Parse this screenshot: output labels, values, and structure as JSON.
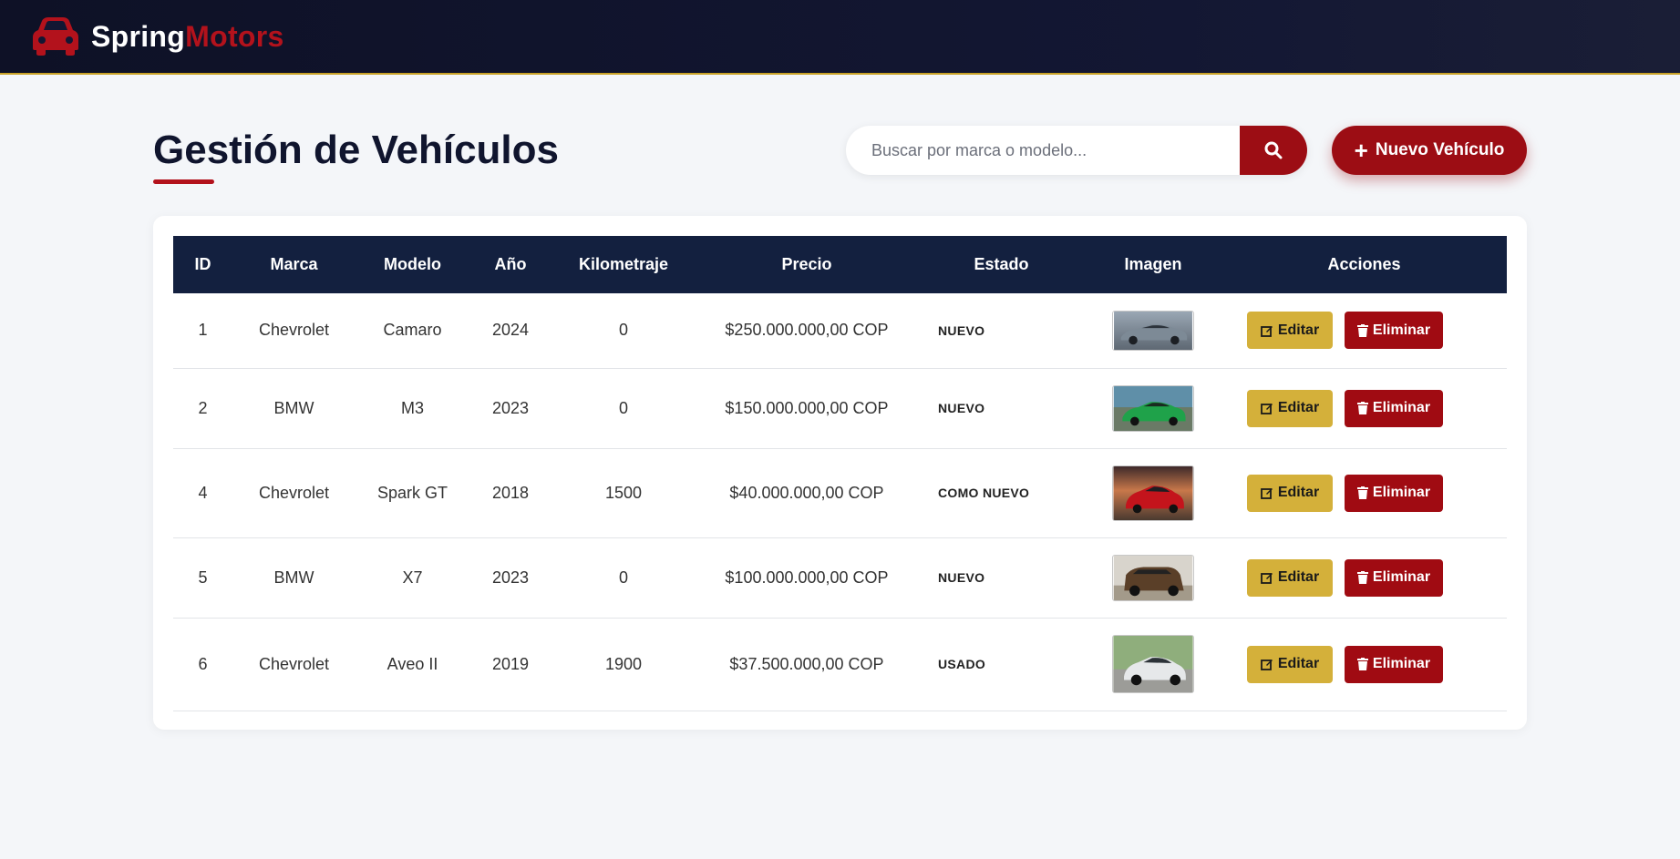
{
  "brand": {
    "part1": "Spring",
    "part2": "Motors",
    "icon": "car-icon"
  },
  "page": {
    "title": "Gestión de Vehículos"
  },
  "search": {
    "placeholder": "Buscar por marca o modelo...",
    "value": "",
    "button_icon": "search-icon"
  },
  "new_button": {
    "label": "Nuevo Vehículo",
    "icon": "plus-icon"
  },
  "table": {
    "headers": [
      "ID",
      "Marca",
      "Modelo",
      "Año",
      "Kilometraje",
      "Precio",
      "Estado",
      "Imagen",
      "Acciones"
    ],
    "rows": [
      {
        "id": "1",
        "marca": "Chevrolet",
        "modelo": "Camaro",
        "anio": "2024",
        "km": "0",
        "precio": "$250.000.000,00 COP",
        "estado": "NUEVO",
        "image_desc": "gray sports car"
      },
      {
        "id": "2",
        "marca": "BMW",
        "modelo": "M3",
        "anio": "2023",
        "km": "0",
        "precio": "$150.000.000,00 COP",
        "estado": "NUEVO",
        "image_desc": "green sedan"
      },
      {
        "id": "4",
        "marca": "Chevrolet",
        "modelo": "Spark GT",
        "anio": "2018",
        "km": "1500",
        "precio": "$40.000.000,00 COP",
        "estado": "COMO NUEVO",
        "image_desc": "red hatchback sunset"
      },
      {
        "id": "5",
        "marca": "BMW",
        "modelo": "X7",
        "anio": "2023",
        "km": "0",
        "precio": "$100.000.000,00 COP",
        "estado": "NUEVO",
        "image_desc": "brown suv"
      },
      {
        "id": "6",
        "marca": "Chevrolet",
        "modelo": "Aveo II",
        "anio": "2019",
        "km": "1900",
        "precio": "$37.500.000,00 COP",
        "estado": "USADO",
        "image_desc": "white sedan"
      }
    ],
    "edit_label": "Editar",
    "delete_label": "Eliminar"
  },
  "colors": {
    "navbar": "#0e1126",
    "accent_red": "#9c0d14",
    "accent_gold": "#d4b03a",
    "table_header": "#13203f",
    "background": "#f4f6f9"
  }
}
